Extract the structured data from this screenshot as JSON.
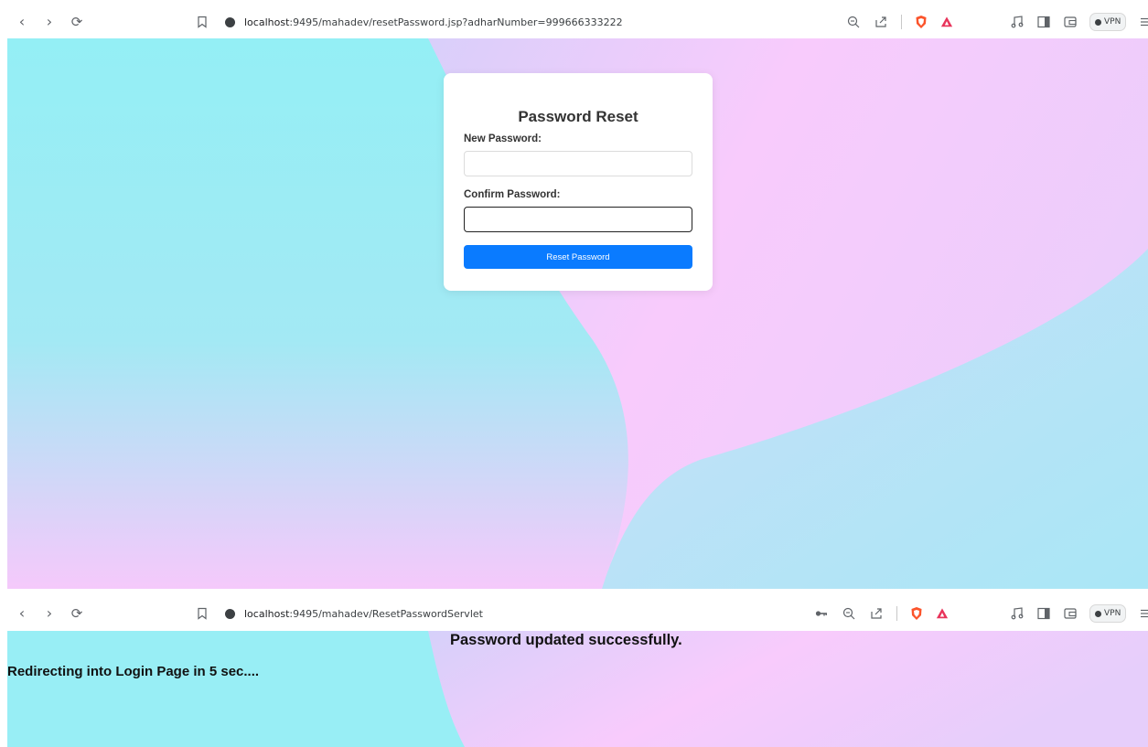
{
  "window1": {
    "url_host": "localhost",
    "url_rest": ":9495/mahadev/resetPassword.jsp?adharNumber=999666333222",
    "vpn_label": "VPN"
  },
  "form": {
    "title": "Password Reset",
    "new_password_label": "New Password:",
    "confirm_password_label": "Confirm Password:",
    "new_password_value": "",
    "confirm_password_value": "",
    "submit_label": "Reset Password"
  },
  "window2": {
    "url_host": "localhost",
    "url_rest": ":9495/mahadev/ResetPasswordServlet",
    "vpn_label": "VPN"
  },
  "result": {
    "success_message": "Password updated successfully.",
    "redirect_message": "Redirecting into Login Page in 5 sec...."
  },
  "colors": {
    "accent": "#0a7bff",
    "brave": "#fb542b",
    "brave_triangle": "#e8345a"
  },
  "icons": [
    "back-icon",
    "forward-icon",
    "reload-icon",
    "bookmark-icon",
    "site-info-icon",
    "zoom-icon",
    "share-icon",
    "brave-shield-icon",
    "brave-rewards-icon",
    "media-icon",
    "sidebar-icon",
    "wallet-icon",
    "menu-icon",
    "key-icon"
  ]
}
